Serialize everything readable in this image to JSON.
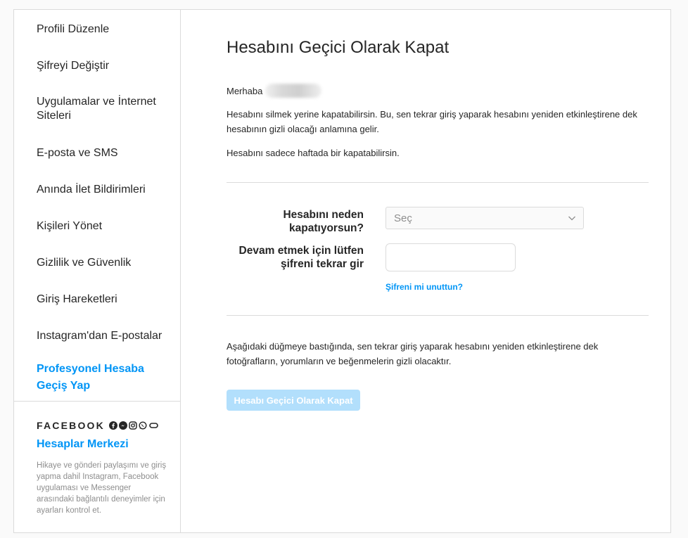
{
  "sidebar": {
    "items": [
      {
        "label": "Profili Düzenle"
      },
      {
        "label": "Şifreyi Değiştir"
      },
      {
        "label": "Uygulamalar ve İnternet Siteleri"
      },
      {
        "label": "E-posta ve SMS"
      },
      {
        "label": "Anında İlet Bildirimleri"
      },
      {
        "label": "Kişileri Yönet"
      },
      {
        "label": "Gizlilik ve Güvenlik"
      },
      {
        "label": "Giriş Hareketleri"
      },
      {
        "label": "Instagram'dan E-postalar"
      },
      {
        "label": "Profesyonel Hesaba Geçiş Yap"
      }
    ],
    "brand": "FACEBOOK",
    "brand_icons": [
      "facebook-icon",
      "messenger-icon",
      "instagram-icon",
      "whatsapp-icon",
      "portal-icon"
    ],
    "accounts_center": "Hesaplar Merkezi",
    "accounts_center_desc": "Hikaye ve gönderi paylaşımı ve giriş yapma dahil Instagram, Facebook uygulaması ve Messenger arasındaki bağlantılı deneyimler için ayarları kontrol et."
  },
  "main": {
    "title": "Hesabını Geçici Olarak Kapat",
    "greeting": "Merhaba",
    "paragraph1": "Hesabını silmek yerine kapatabilirsin. Bu, sen tekrar giriş yaparak hesabını yeniden etkinleştirene dek hesabının gizli olacağı anlamına gelir.",
    "paragraph2": "Hesabını sadece haftada bir kapatabilirsin.",
    "reason_label": "Hesabını neden kapatıyorsun?",
    "reason_value": "Seç",
    "password_label": "Devam etmek için lütfen şifreni tekrar gir",
    "password_value": "",
    "forgot_link": "Şifreni mi unuttun?",
    "notice": "Aşağıdaki düğmeye bastığında, sen tekrar giriş yaparak hesabını yeniden etkinleştirene dek fotoğrafların, yorumların ve beğenmelerin gizli olacaktır.",
    "submit_label": "Hesabı Geçici Olarak Kapat"
  },
  "colors": {
    "accent": "#0095f6",
    "button_disabled": "#b2dffc",
    "border": "#dbdbdb",
    "muted_text": "#8e8e8e"
  }
}
